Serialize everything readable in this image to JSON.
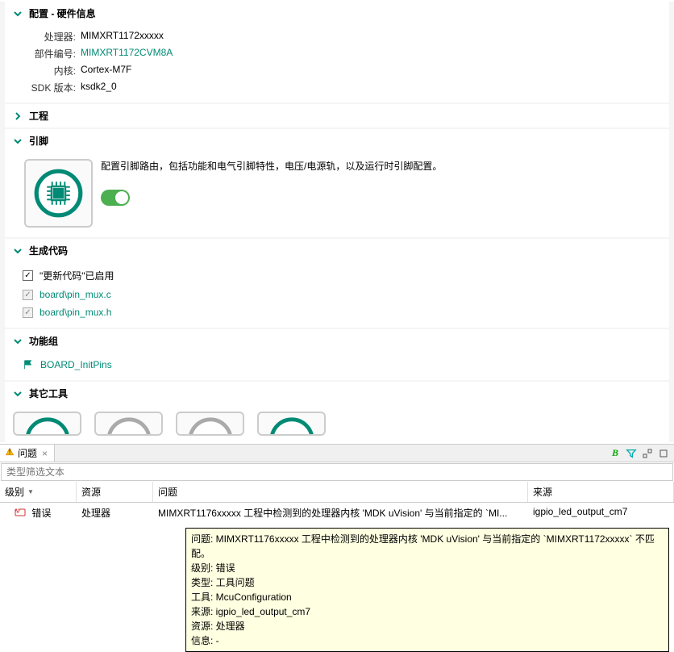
{
  "sections": {
    "config": {
      "title": "配置 - 硬件信息",
      "processor_label": "处理器:",
      "processor_value": "MIMXRT1172xxxxx",
      "part_label": "部件编号:",
      "part_value": "MIMXRT1172CVM8A",
      "core_label": "内核:",
      "core_value": "Cortex-M7F",
      "sdk_label": "SDK 版本:",
      "sdk_value": "ksdk2_0"
    },
    "project": {
      "title": "工程"
    },
    "pins": {
      "title": "引脚",
      "desc": "配置引脚路由，包括功能和电气引脚特性，电压/电源轨，以及运行时引脚配置。"
    },
    "gencode": {
      "title": "生成代码",
      "update_label": "\"更新代码\"已启用",
      "files": [
        "board\\pin_mux.c",
        "board\\pin_mux.h"
      ]
    },
    "funcgroup": {
      "title": "功能组",
      "items": [
        "BOARD_InitPins"
      ]
    },
    "other": {
      "title": "其它工具"
    }
  },
  "problems": {
    "tab_title": "问题",
    "filter_placeholder": "类型筛选文本",
    "columns": {
      "level": "级别",
      "resource": "资源",
      "problem": "问题",
      "source": "来源"
    },
    "row": {
      "level": "错误",
      "resource": "处理器",
      "problem": "MIMXRT1176xxxxx 工程中检测到的处理器内核 'MDK uVision' 与当前指定的 `MI...",
      "source": "igpio_led_output_cm7"
    },
    "tooltip": {
      "l1": "问题: MIMXRT1176xxxxx 工程中检测到的处理器内核 'MDK uVision' 与当前指定的 `MIMXRT1172xxxxx` 不匹配。",
      "l2": "级别: 错误",
      "l3": "类型: 工具问题",
      "l4": "工具: McuConfiguration",
      "l5": "来源: igpio_led_output_cm7",
      "l6": "资源: 处理器",
      "l7": "信息: -"
    }
  }
}
